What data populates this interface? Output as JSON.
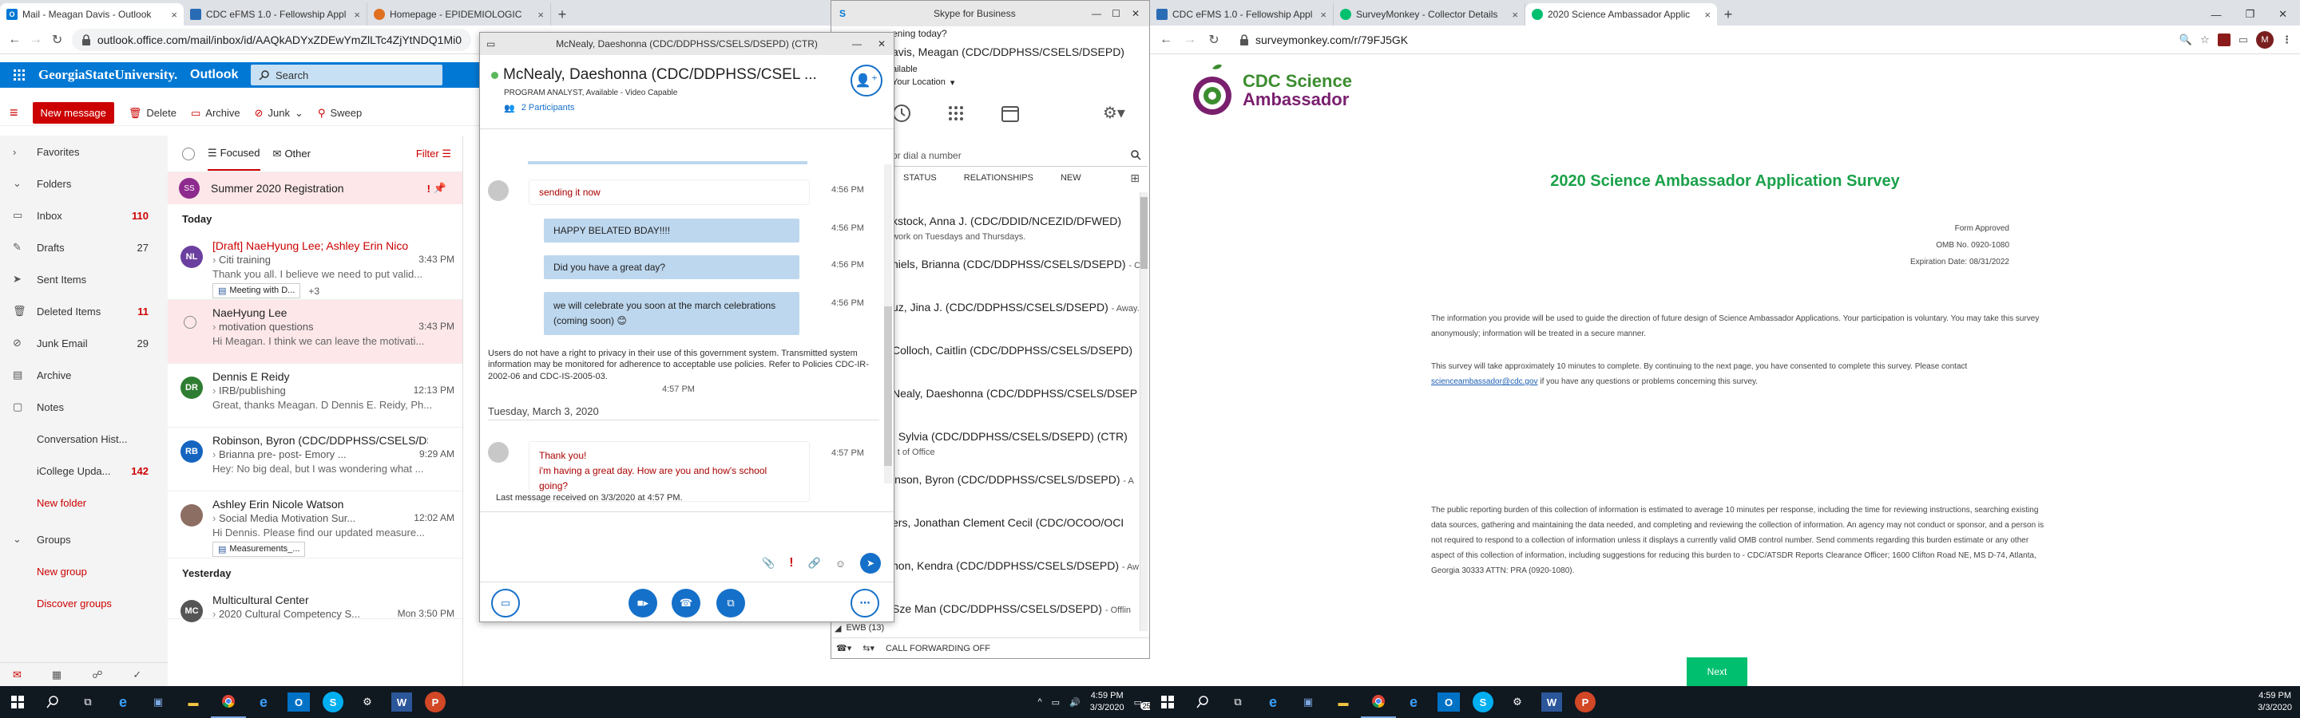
{
  "left_browser": {
    "tabs": [
      {
        "title": "Mail - Meagan Davis - Outlook",
        "fav_color": "#0078d4",
        "fav_letter": "O"
      },
      {
        "title": "CDC eFMS 1.0 - Fellowship Appl",
        "fav_color": "#2a6bb5",
        "fav_letter": ""
      },
      {
        "title": "Homepage - EPIDEMIOLOGIC",
        "fav_color": "#e07020",
        "fav_letter": ""
      }
    ],
    "url": "outlook.office.com/mail/inbox/id/AAQkADYxZDEwYmZlLTc4ZjYtNDQ1Mi0"
  },
  "outlook": {
    "org": "GeorgiaStateUniversity.",
    "app": "Outlook",
    "search_placeholder": "Search",
    "new_message": "New message",
    "cmd": [
      "Delete",
      "Archive",
      "Junk",
      "Sweep"
    ],
    "nav": [
      {
        "label": "Favorites",
        "count": "",
        "icon": "chevron-right-icon",
        "link": false
      },
      {
        "label": "Folders",
        "count": "",
        "icon": "chevron-down-icon",
        "link": false
      },
      {
        "label": "Inbox",
        "count": "110",
        "icon": "inbox-icon",
        "link": false
      },
      {
        "label": "Drafts",
        "count": "27",
        "icon": "pencil-icon",
        "link": false
      },
      {
        "label": "Sent Items",
        "count": "",
        "icon": "send-icon",
        "link": false
      },
      {
        "label": "Deleted Items",
        "count": "11",
        "icon": "trash-icon",
        "link": false
      },
      {
        "label": "Junk Email",
        "count": "29",
        "icon": "block-icon",
        "link": false
      },
      {
        "label": "Archive",
        "count": "",
        "icon": "archive-icon",
        "link": false
      },
      {
        "label": "Notes",
        "count": "",
        "icon": "note-icon",
        "link": false
      },
      {
        "label": "Conversation Hist...",
        "count": "",
        "icon": "",
        "link": false
      },
      {
        "label": "iCollege Upda...",
        "count": "142",
        "icon": "",
        "link": false
      },
      {
        "label": "New folder",
        "count": "",
        "icon": "",
        "link": true
      },
      {
        "label": "Groups",
        "count": "",
        "icon": "chevron-down-icon",
        "link": false
      },
      {
        "label": "New group",
        "count": "",
        "icon": "",
        "link": true
      },
      {
        "label": "Discover groups",
        "count": "",
        "icon": "",
        "link": true
      }
    ],
    "focused": "Focused",
    "other": "Other",
    "filter": "Filter",
    "pinned": {
      "initials": "SS",
      "title": "Summer 2020 Registration"
    },
    "today": "Today",
    "yesterday": "Yesterday",
    "mails": [
      {
        "initials": "NL",
        "color": "#6b3fa0",
        "from": "[Draft] NaeHyung Lee; Ashley Erin Nico",
        "subject": "Citi training",
        "time": "3:43 PM",
        "preview": "Thank you all. I believe we need to put valid...",
        "attach": "Meeting with D...",
        "extra": "+3",
        "highlight": false
      },
      {
        "initials": "",
        "color": "",
        "from": "NaeHyung Lee",
        "subject": "motivation questions",
        "time": "3:43 PM",
        "preview": "Hi Meagan. I think we can leave the motivati...",
        "attach": "",
        "extra": "",
        "highlight": true
      },
      {
        "initials": "DR",
        "color": "#2e7d32",
        "from": "Dennis E Reidy",
        "subject": "IRB/publishing",
        "time": "12:13 PM",
        "preview": "Great, thanks Meagan. D Dennis E. Reidy, Ph...",
        "attach": "",
        "extra": "",
        "highlight": false
      },
      {
        "initials": "RB",
        "color": "#1565c0",
        "from": "Robinson, Byron (CDC/DDPHSS/CSELS/DS",
        "subject": "Brianna pre- post- Emory ...",
        "time": "9:29 AM",
        "preview": "Hey: No big deal, but I was wondering what ...",
        "attach": "",
        "extra": "",
        "highlight": false
      },
      {
        "initials": "",
        "color": "#8d6e63",
        "from": "Ashley Erin Nicole Watson",
        "subject": "Social Media Motivation Sur...",
        "time": "12:02 AM",
        "preview": "Hi Dennis. Please find our updated measure...",
        "attach": "Measurements_...",
        "extra": "",
        "highlight": false
      },
      {
        "initials": "MC",
        "color": "#555",
        "from": "Multicultural Center",
        "subject": "2020 Cultural Competency S...",
        "time": "Mon 3:50 PM",
        "preview": "",
        "attach": "",
        "extra": "",
        "highlight": false
      }
    ]
  },
  "chat": {
    "window_title": "McNealy, Daeshonna (CDC/DDPHSS/CSELS/DSEPD) (CTR)",
    "name": "McNealy, Daeshonna (CDC/DDPHSS/CSEL ...",
    "status": "PROGRAM ANALYST, Available - Video Capable",
    "participants": "2 Participants",
    "messages": [
      {
        "text": "sending it now",
        "time": "4:56 PM",
        "me": false
      },
      {
        "text": "HAPPY BELATED BDAY!!!!",
        "time": "4:56 PM",
        "me": true
      },
      {
        "text": "Did you have a great day?",
        "time": "4:56 PM",
        "me": true
      },
      {
        "text": "we will celebrate you soon at the march celebrations (coming soon)",
        "time": "4:56 PM",
        "me": true
      }
    ],
    "disclaimer": "Users do not have a right to privacy in their use of this government system. Transmitted system information may be monitored for adherence to acceptable use policies. Refer to Policies CDC-IR-2002-06 and CDC-IS-2005-03.",
    "disclaimer_time": "4:57 PM",
    "date": "Tuesday, March 3, 2020",
    "reply_lines": [
      "Thank you!",
      "i'm having a great day. How are you and how's school",
      "going?"
    ],
    "reply_time": "4:57 PM",
    "last": "Last message received on 3/3/2020 at 4:57 PM."
  },
  "skype": {
    "title": "Skype for Business",
    "greeting": "ening today?",
    "me": "avis, Meagan (CDC/DDPHSS/CSELS/DSEPD)",
    "avail": "ailable",
    "location": "Your Location",
    "search": "or dial a number",
    "tabs": [
      "STATUS",
      "RELATIONSHIPS",
      "NEW"
    ],
    "contacts": [
      {
        "name": "kstock, Anna J. (CDC/DDID/NCEZID/DFWED)",
        "sub": "work on Tuesdays and Thursdays."
      },
      {
        "name": "niels, Brianna (CDC/DDPHSS/CSELS/DSEPD)",
        "sub": "- C"
      },
      {
        "name": "uz, Jina J. (CDC/DDPHSS/CSELS/DSEPD)",
        "sub": "- Away."
      },
      {
        "name": "Colloch, Caitlin (CDC/DDPHSS/CSELS/DSEPD)",
        "sub": ""
      },
      {
        "name": "Nealy, Daeshonna (CDC/DDPHSS/CSELS/DSEP",
        "sub": ""
      },
      {
        "name": ", Sylvia (CDC/DDPHSS/CSELS/DSEPD) (CTR)",
        "sub": "- t of Office"
      },
      {
        "name": "inson, Byron (CDC/DDPHSS/CSELS/DSEPD)",
        "sub": "- A"
      },
      {
        "name": "ers, Jonathan Clement Cecil (CDC/OCOO/OCI",
        "sub": ""
      },
      {
        "name": "non, Kendra (CDC/DDPHSS/CSELS/DSEPD)",
        "sub": "- Aw"
      },
      {
        "name": "Sze Man (CDC/DDPHSS/CSELS/DSEPD)",
        "sub": "- Offlin"
      }
    ],
    "ewb": "EWB (13)",
    "forwarding": "CALL FORWARDING OFF"
  },
  "right_browser": {
    "tabs": [
      {
        "title": "CDC eFMS 1.0 - Fellowship Appl",
        "fav_color": "#2a6bb5"
      },
      {
        "title": "SurveyMonkey - Collector Details",
        "fav_color": "#00bf6f"
      },
      {
        "title": "2020 Science Ambassador Applic",
        "fav_color": "#00bf6f"
      }
    ],
    "url": "surveymonkey.com/r/79FJ5GK"
  },
  "survey": {
    "logo_line1": "CDC Science",
    "logo_line2": "Ambassador",
    "title": "2020 Science Ambassador Application Survey",
    "form_lines": [
      "Form Approved",
      "OMB No. 0920-1080",
      "Expiration Date: 08/31/2022"
    ],
    "p1": "The information you provide will be used to guide the direction of future design of Science Ambassador Applications. Your participation is voluntary. You may take this survey anonymously; information will be treated in a secure manner.",
    "p2a": "This survey will take approximately 10 minutes to complete. By continuing to the next page, you have consented to complete this survey. Please contact",
    "p2_link": "scienceambassador@cdc.gov",
    "p2b": " if you have any questions or problems concerning this survey.",
    "p3": "The public reporting burden of this collection of information is estimated to average 10 minutes per response, including the time for reviewing instructions, searching existing data sources, gathering and maintaining the data needed, and completing and reviewing the collection of information. An agency may not conduct or sponsor, and a person is not required to respond to a collection of information unless it displays a currently valid OMB control number. Send comments regarding this burden estimate or any other aspect of this collection of information, including suggestions for reducing this burden to - CDC/ATSDR Reports Clearance Officer; 1600 Clifton Road NE, MS D-74, Atlanta, Georgia 30333 ATTN: PRA (0920-1080).",
    "next": "Next"
  },
  "taskbar": {
    "time": "4:59 PM",
    "date": "3/3/2020",
    "badge": "25"
  }
}
